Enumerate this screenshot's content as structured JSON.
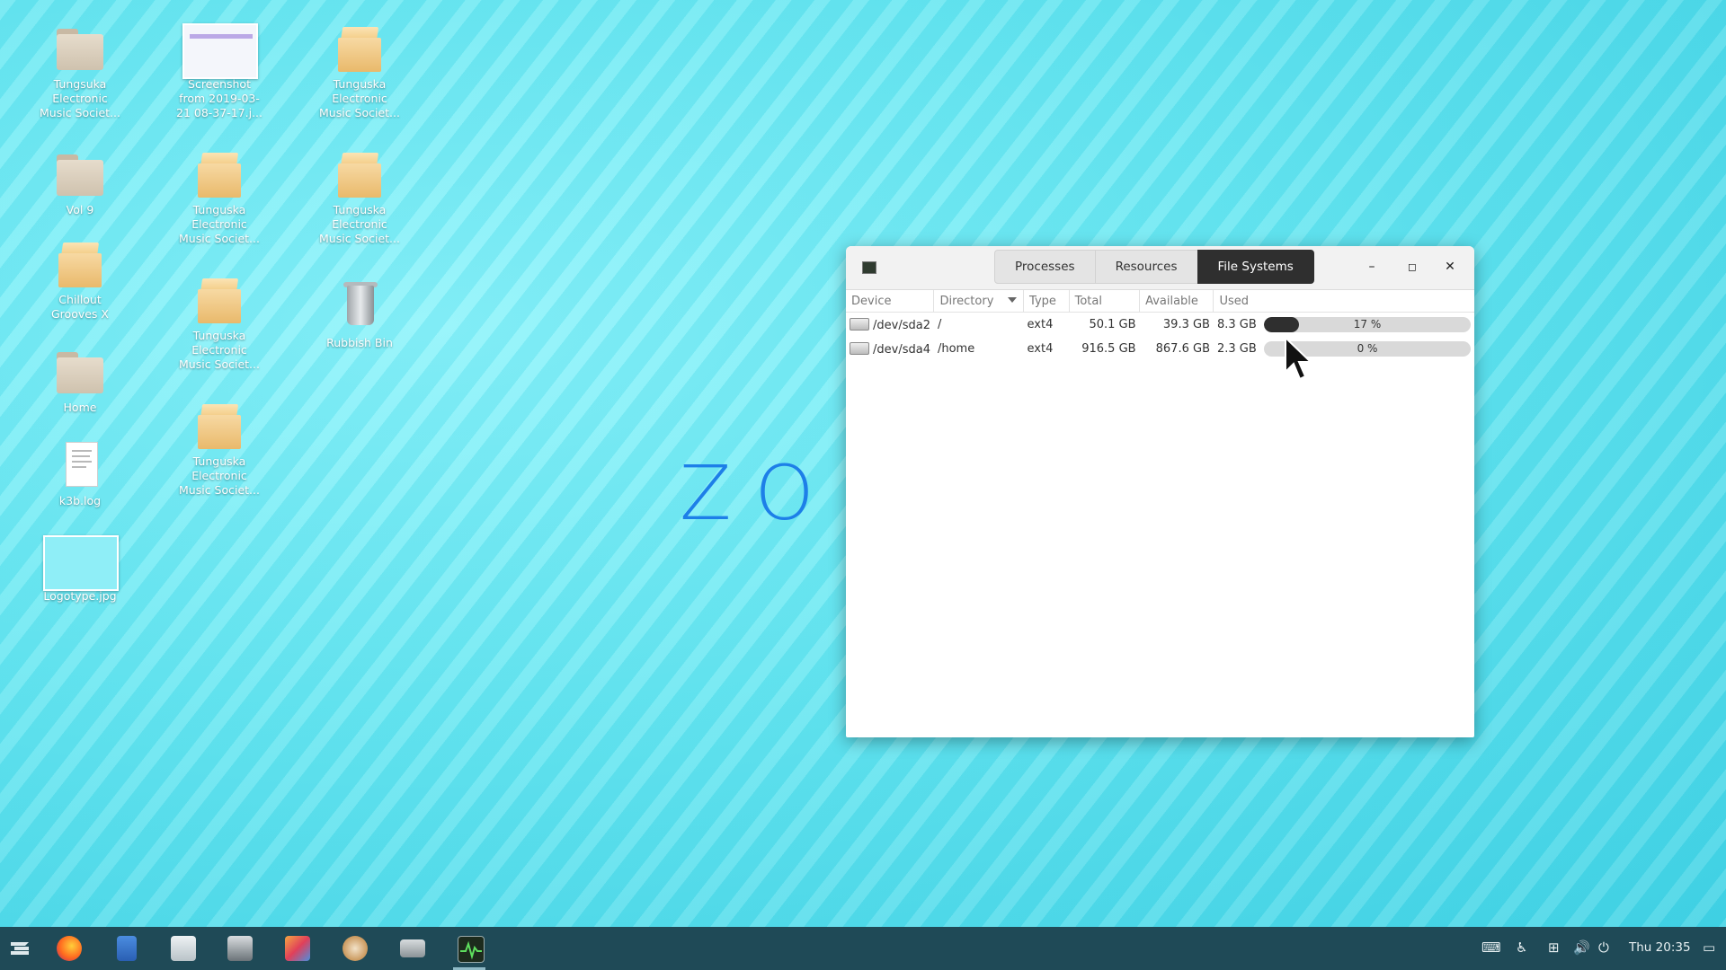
{
  "desktop": {
    "icons": [
      {
        "label": "Tungsuka\nElectronic\nMusic Societ...",
        "kind": "folder"
      },
      {
        "label": "Screenshot\nfrom 2019-03-\n21 08-37-17.j...",
        "kind": "image"
      },
      {
        "label": "Tunguska\nElectronic\nMusic Societ...",
        "kind": "box"
      },
      {
        "label": "Vol 9",
        "kind": "folder"
      },
      {
        "label": "Tunguska\nElectronic\nMusic Societ...",
        "kind": "box"
      },
      {
        "label": "Tunguska\nElectronic\nMusic Societ...",
        "kind": "box"
      },
      {
        "label": "Chillout\nGrooves X",
        "kind": "box"
      },
      {
        "label": "Tunguska\nElectronic\nMusic Societ...",
        "kind": "box"
      },
      {
        "label": "Rubbish Bin",
        "kind": "trash"
      },
      {
        "label": "Home",
        "kind": "folder-home"
      },
      {
        "label": "Tunguska\nElectronic\nMusic Societ...",
        "kind": "box"
      },
      {
        "label": "k3b.log",
        "kind": "document"
      },
      {
        "label": "Logotype.jpg",
        "kind": "image"
      }
    ],
    "wallpaper_text": "ZO"
  },
  "window": {
    "tabs": [
      "Processes",
      "Resources",
      "File Systems"
    ],
    "active_tab": "File Systems",
    "controls": {
      "minimize": "–",
      "maximize": "◻",
      "close": "✕"
    },
    "columns": [
      "Device",
      "Directory",
      "Type",
      "Total",
      "Available",
      "Used"
    ],
    "rows": [
      {
        "device": "/dev/sda2",
        "directory": "/",
        "type": "ext4",
        "total": "50.1 GB",
        "available": "39.3 GB",
        "used": "8.3 GB",
        "percent_text": "17 %",
        "percent": 17
      },
      {
        "device": "/dev/sda4",
        "directory": "/home",
        "type": "ext4",
        "total": "916.5 GB",
        "available": "867.6 GB",
        "used": "2.3 GB",
        "percent_text": "0 %",
        "percent": 0
      }
    ]
  },
  "taskbar": {
    "apps": [
      "zorin-menu-icon",
      "firefox-icon",
      "files-icon",
      "software-icon",
      "screenshot-icon",
      "settings-icon",
      "backup-icon",
      "drives-icon",
      "system-monitor-icon"
    ],
    "clock": "Thu 20:35"
  },
  "colors": {
    "taskbar": "#1f4a57",
    "wallpaper": "#6fe6f0",
    "active_tab": "#2f2f2f",
    "logo": "#1d7fe8"
  }
}
